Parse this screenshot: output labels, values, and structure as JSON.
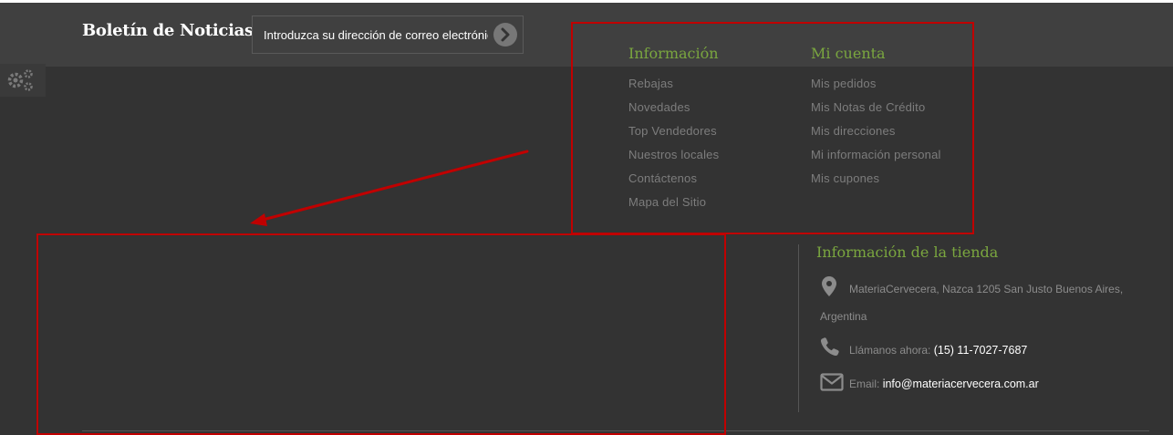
{
  "newsletter": {
    "title": "Boletín de Noticias",
    "placeholder": "Introduzca su dirección de correo electrónico"
  },
  "info_column": {
    "title": "Información",
    "links": [
      "Rebajas",
      "Novedades",
      "Top Vendedores",
      "Nuestros locales",
      "Contáctenos",
      "Mapa del Sitio"
    ]
  },
  "account_column": {
    "title": "Mi cuenta",
    "links": [
      "Mis pedidos",
      "Mis Notas de Crédito",
      "Mis direcciones",
      "Mi información personal",
      "Mis cupones"
    ]
  },
  "store_info": {
    "title": "Información de la tienda",
    "address_line1": "MateriaCervecera, Nazca 1205 San Justo Buenos Aires,",
    "address_line2": "Argentina",
    "phone_label": "Llámanos ahora:",
    "phone": "(15) 11-7027-7687",
    "email_label": "Email:",
    "email": "info@materiacervecera.com.ar"
  },
  "icons": {
    "settings": "gears-icon",
    "submit": "chevron-right-icon",
    "address": "map-marker-icon",
    "phone": "phone-icon",
    "email": "envelope-icon"
  },
  "colors": {
    "background": "#333333",
    "accent_green": "#7aa63f",
    "annotation_red": "#c00000",
    "link_gray": "#7d7d7d"
  }
}
